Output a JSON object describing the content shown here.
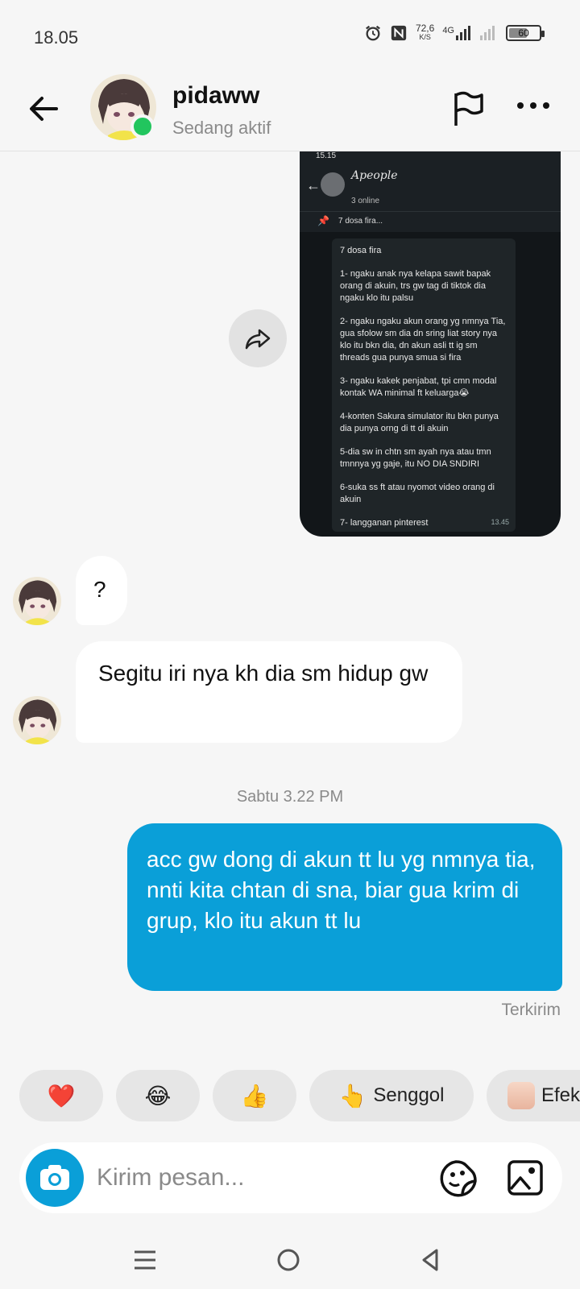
{
  "status_bar": {
    "time": "18.05",
    "speed_value": "72,6",
    "speed_unit": "K/S",
    "network": "4G",
    "battery": "60"
  },
  "header": {
    "name": "pidaww",
    "status": "Sedang aktif"
  },
  "shared_screenshot": {
    "time": "15.15",
    "group_name": "Apeople",
    "online": "3 online",
    "pinned": "7 dosa fira...",
    "lines": [
      "7 dosa fira",
      "1- ngaku anak nya kelapa sawit bapak orang di akuin, trs gw tag di tiktok dia ngaku klo itu palsu",
      "2- ngaku ngaku akun orang yg nmnya Tia, gua sfolow sm dia dn sring liat story nya klo itu bkn dia, dn akun asli tt ig sm threads gua punya smua si fira",
      "3- ngaku kakek penjabat, tpi cmn modal kontak WA minimal ft keluarga😭",
      "4-konten Sakura simulator itu bkn punya dia punya orng di tt di akuin",
      "5-dia sw in chtn sm ayah nya atau tmn tmnnya yg gaje, itu NO DIA SNDIRI",
      "6-suka ss ft atau nyomot video orang di akuin",
      "7- langganan pinterest"
    ],
    "msg_time": "13.45"
  },
  "messages": {
    "received_1": "?",
    "received_2": "Segitu iri nya kh dia sm hidup gw",
    "date_separator": "Sabtu 3.22 PM",
    "sent_1": "acc gw dong di akun tt lu yg nmnya tia, nnti kita chtan di sna, biar gua krim di grup, klo itu akun tt lu",
    "sent_status": "Terkirim"
  },
  "quick_reactions": {
    "heart": "❤️",
    "laugh": "😂",
    "thumbs": "👍",
    "nudge_emoji": "👆",
    "nudge_label": "Senggol",
    "effect_label": "Efek"
  },
  "composer": {
    "placeholder": "Kirim pesan..."
  },
  "colors": {
    "accent": "#0a9fd8",
    "online": "#22c55e"
  }
}
